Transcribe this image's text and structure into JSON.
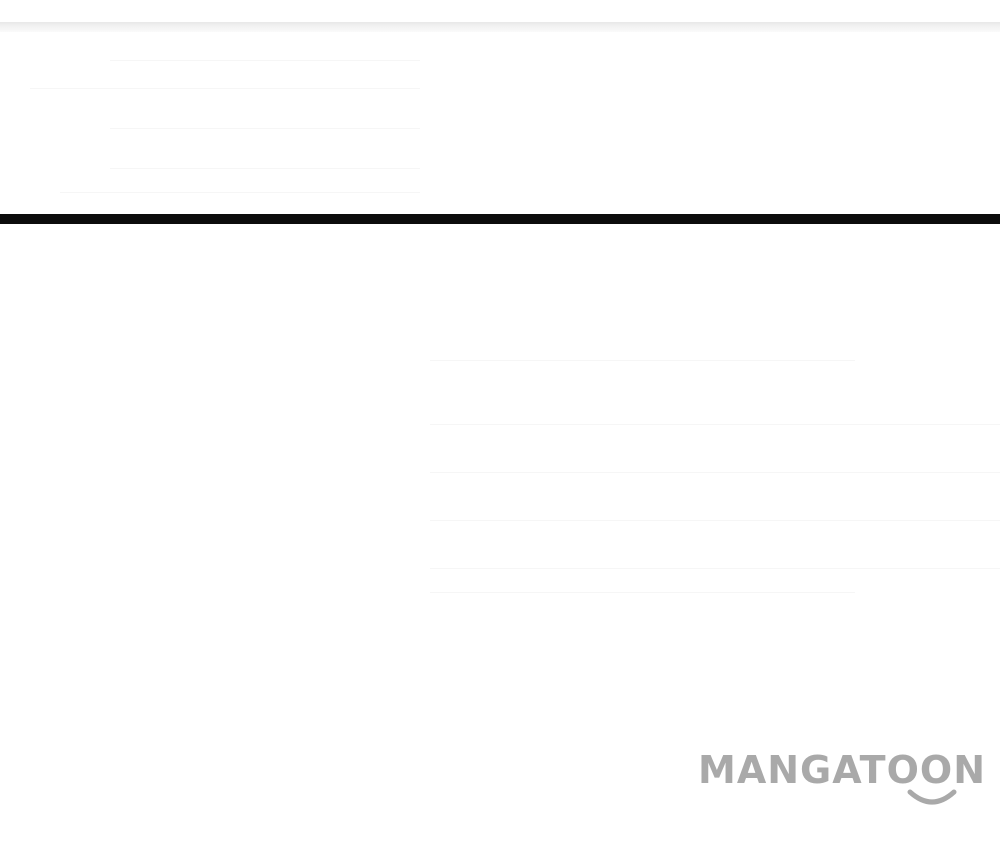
{
  "watermark": {
    "text": "MANGATOON",
    "color": "#a9a9a9",
    "icon": "smile-icon"
  },
  "colors": {
    "background": "#ffffff",
    "panel_border": "#0c0c0c"
  }
}
